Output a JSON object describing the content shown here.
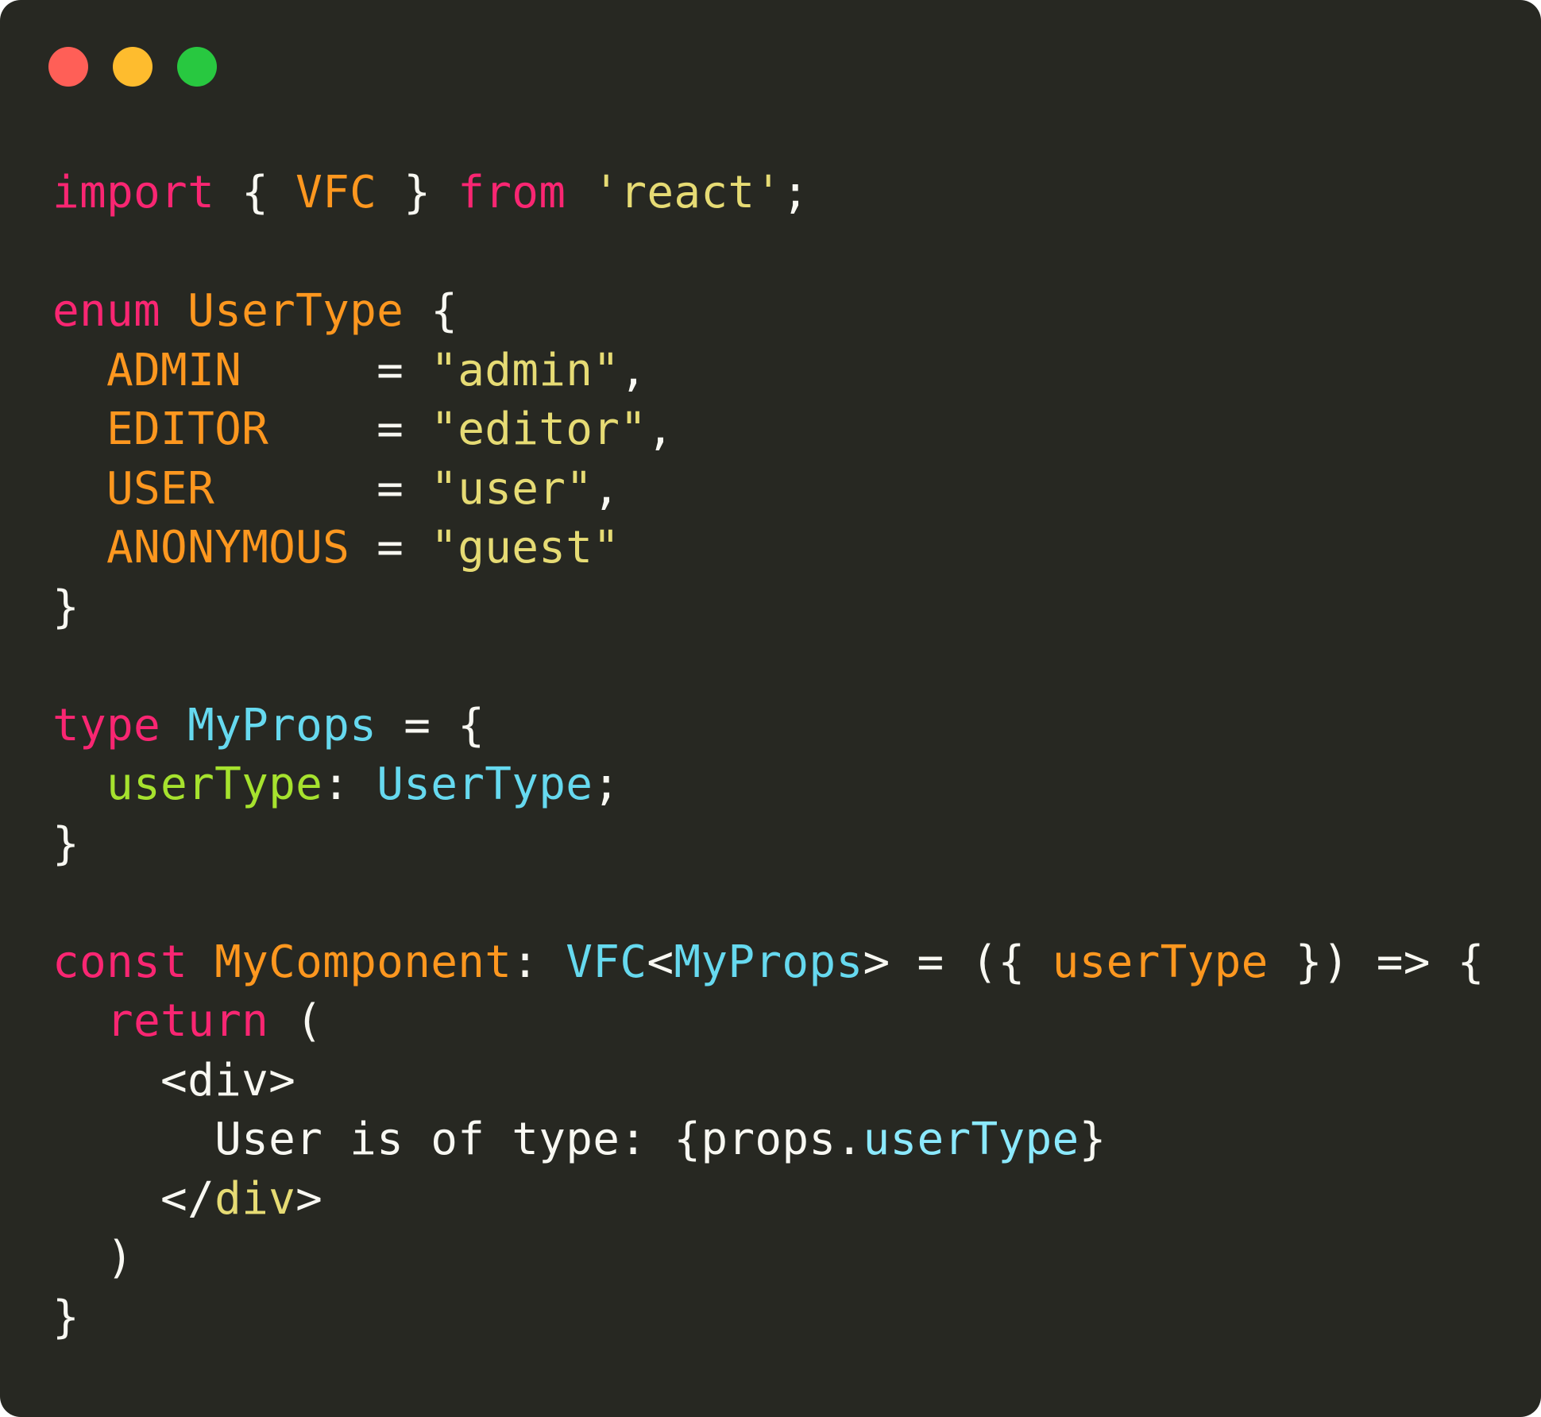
{
  "window": {
    "controls": [
      {
        "name": "close-button",
        "color": "#ff5f57"
      },
      {
        "name": "minimize-button",
        "color": "#febc2e"
      },
      {
        "name": "maximize-button",
        "color": "#28c840"
      }
    ]
  },
  "code": {
    "lines": [
      [
        {
          "t": "import",
          "c": "kw"
        },
        {
          "t": " { ",
          "c": "plain"
        },
        {
          "t": "VFC",
          "c": "ent"
        },
        {
          "t": " } ",
          "c": "plain"
        },
        {
          "t": "from",
          "c": "kw"
        },
        {
          "t": " ",
          "c": "plain"
        },
        {
          "t": "'react'",
          "c": "str"
        },
        {
          "t": ";",
          "c": "plain"
        }
      ],
      [],
      [
        {
          "t": "enum",
          "c": "kw"
        },
        {
          "t": " ",
          "c": "plain"
        },
        {
          "t": "UserType",
          "c": "ent"
        },
        {
          "t": " {",
          "c": "plain"
        }
      ],
      [
        {
          "t": "  ",
          "c": "plain"
        },
        {
          "t": "ADMIN",
          "c": "ent"
        },
        {
          "t": "     = ",
          "c": "plain"
        },
        {
          "t": "\"admin\"",
          "c": "str"
        },
        {
          "t": ",",
          "c": "plain"
        }
      ],
      [
        {
          "t": "  ",
          "c": "plain"
        },
        {
          "t": "EDITOR",
          "c": "ent"
        },
        {
          "t": "    = ",
          "c": "plain"
        },
        {
          "t": "\"editor\"",
          "c": "str"
        },
        {
          "t": ",",
          "c": "plain"
        }
      ],
      [
        {
          "t": "  ",
          "c": "plain"
        },
        {
          "t": "USER",
          "c": "ent"
        },
        {
          "t": "      = ",
          "c": "plain"
        },
        {
          "t": "\"user\"",
          "c": "str"
        },
        {
          "t": ",",
          "c": "plain"
        }
      ],
      [
        {
          "t": "  ",
          "c": "plain"
        },
        {
          "t": "ANONYMOUS",
          "c": "ent"
        },
        {
          "t": " = ",
          "c": "plain"
        },
        {
          "t": "\"guest\"",
          "c": "str"
        }
      ],
      [
        {
          "t": "}",
          "c": "plain"
        }
      ],
      [],
      [
        {
          "t": "type",
          "c": "kw"
        },
        {
          "t": " ",
          "c": "plain"
        },
        {
          "t": "MyProps",
          "c": "typ"
        },
        {
          "t": " = {",
          "c": "plain"
        }
      ],
      [
        {
          "t": "  ",
          "c": "plain"
        },
        {
          "t": "userType",
          "c": "fn"
        },
        {
          "t": ": ",
          "c": "plain"
        },
        {
          "t": "UserType",
          "c": "typ"
        },
        {
          "t": ";",
          "c": "plain"
        }
      ],
      [
        {
          "t": "}",
          "c": "plain"
        }
      ],
      [],
      [
        {
          "t": "const",
          "c": "kw"
        },
        {
          "t": " ",
          "c": "plain"
        },
        {
          "t": "MyComponent",
          "c": "ent"
        },
        {
          "t": ": ",
          "c": "plain"
        },
        {
          "t": "VFC",
          "c": "typ"
        },
        {
          "t": "<",
          "c": "plain"
        },
        {
          "t": "MyProps",
          "c": "typ"
        },
        {
          "t": "> = ({ ",
          "c": "plain"
        },
        {
          "t": "userType",
          "c": "ent"
        },
        {
          "t": " }) => {",
          "c": "plain"
        }
      ],
      [
        {
          "t": "  ",
          "c": "plain"
        },
        {
          "t": "return",
          "c": "kw"
        },
        {
          "t": " (",
          "c": "plain"
        }
      ],
      [
        {
          "t": "    <div>",
          "c": "plain"
        }
      ],
      [
        {
          "t": "      User is of type: {props.",
          "c": "plain"
        },
        {
          "t": "userType",
          "c": "cyan"
        },
        {
          "t": "}",
          "c": "plain"
        }
      ],
      [
        {
          "t": "    </",
          "c": "plain"
        },
        {
          "t": "div",
          "c": "str"
        },
        {
          "t": ">",
          "c": "plain"
        }
      ],
      [
        {
          "t": "  )",
          "c": "plain"
        }
      ],
      [
        {
          "t": "}",
          "c": "plain"
        }
      ]
    ]
  }
}
